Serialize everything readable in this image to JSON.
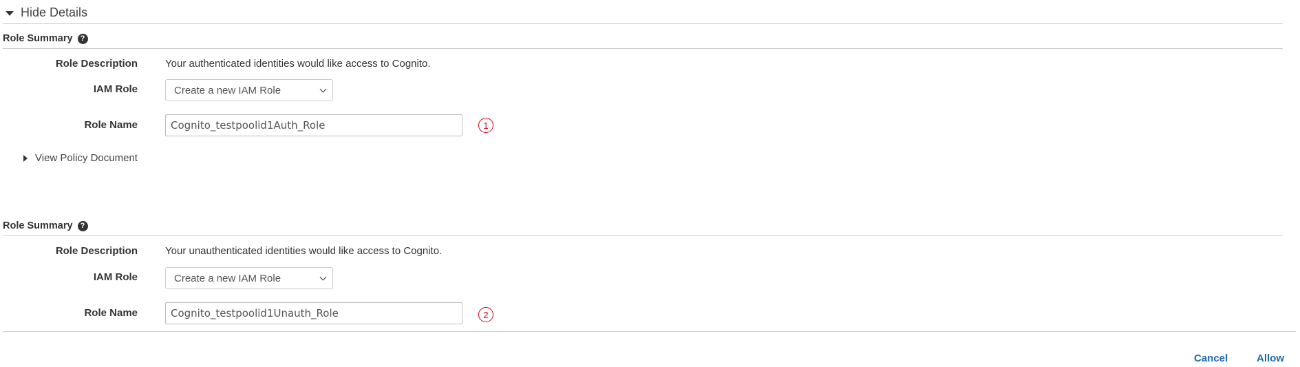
{
  "details_toggle": {
    "label": "Hide Details",
    "icon": "caret-down-icon"
  },
  "role_summaries": [
    {
      "title": "Role Summary",
      "help_icon": "question-circle-icon",
      "description_label": "Role Description",
      "description": "Your authenticated identities would like access to Cognito.",
      "iam_role_label": "IAM Role",
      "iam_role_selected": "Create a new IAM Role",
      "role_name_label": "Role Name",
      "role_name_value": "Cognito_testpoolid1Auth_Role",
      "marker": "1",
      "view_policy_label": "View Policy Document"
    },
    {
      "title": "Role Summary",
      "help_icon": "question-circle-icon",
      "description_label": "Role Description",
      "description": "Your unauthenticated identities would like access to Cognito.",
      "iam_role_label": "IAM Role",
      "iam_role_selected": "Create a new IAM Role",
      "role_name_label": "Role Name",
      "role_name_value": "Cognito_testpoolid1Unauth_Role",
      "marker": "2"
    }
  ],
  "actions": {
    "cancel_label": "Cancel",
    "allow_label": "Allow"
  },
  "colors": {
    "link": "#1e6ab0",
    "marker": "#d0021b",
    "divider": "#cccccc"
  }
}
